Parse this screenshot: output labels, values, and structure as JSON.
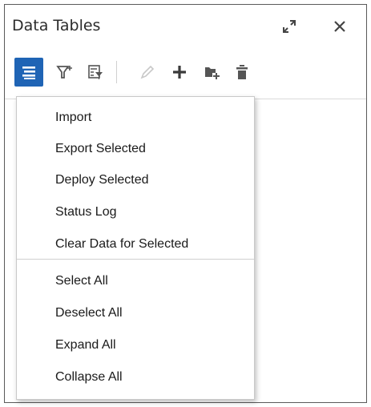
{
  "window": {
    "title": "Data Tables",
    "expand_icon": "expand-arrows-icon",
    "close_icon": "close-icon"
  },
  "toolbar": {
    "buttons": [
      {
        "icon": "menu-icon",
        "active": true
      },
      {
        "icon": "filter-icon",
        "active": false
      },
      {
        "icon": "column-filter-icon",
        "active": false
      },
      {
        "icon": "edit-pencil-icon",
        "active": false,
        "disabled": true
      },
      {
        "icon": "add-plus-icon",
        "active": false
      },
      {
        "icon": "add-folder-icon",
        "active": false
      },
      {
        "icon": "delete-trash-icon",
        "active": false
      }
    ],
    "active_color": "#1f64b5"
  },
  "menu": {
    "group1": [
      "Import",
      "Export Selected",
      "Deploy Selected",
      "Status Log",
      "Clear Data for Selected"
    ],
    "group2": [
      "Select All",
      "Deselect All",
      "Expand All",
      "Collapse All"
    ]
  }
}
